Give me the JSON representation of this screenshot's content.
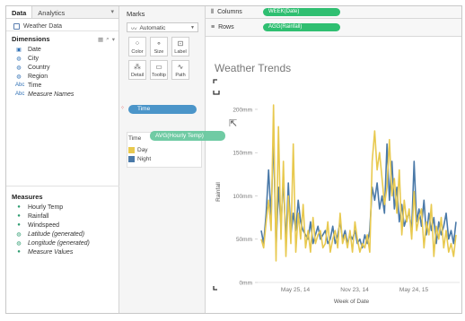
{
  "data_pane": {
    "tabs": [
      {
        "label": "Data",
        "active": true
      },
      {
        "label": "Analytics",
        "active": false
      }
    ],
    "datasource": "Weather Data",
    "dimensions_header": "Dimensions",
    "dimensions": [
      {
        "label": "Date",
        "icon": "calendar-icon"
      },
      {
        "label": "City",
        "icon": "globe-icon"
      },
      {
        "label": "Country",
        "icon": "globe-icon"
      },
      {
        "label": "Region",
        "icon": "globe-icon"
      },
      {
        "label": "Time",
        "icon": "abc-icon"
      },
      {
        "label": "Measure Names",
        "icon": "abc-icon",
        "italic": true
      }
    ],
    "measures_header": "Measures",
    "measures": [
      {
        "label": "Hourly Temp",
        "italic": false
      },
      {
        "label": "Rainfall",
        "italic": false
      },
      {
        "label": "Windspeed",
        "italic": false
      },
      {
        "label": "Latitude (generated)",
        "italic": true
      },
      {
        "label": "Longitude (generated)",
        "italic": true
      },
      {
        "label": "Measure Values",
        "italic": true
      }
    ]
  },
  "marks": {
    "title": "Marks",
    "mark_type": "Automatic",
    "buttons": [
      "Color",
      "Size",
      "Label",
      "Detail",
      "Tooltip",
      "Path"
    ],
    "color_pill": "Time",
    "legend_title": "Time",
    "legend_items": [
      {
        "label": "Day",
        "color": "#e8c94f"
      },
      {
        "label": "Night",
        "color": "#4a79a8"
      }
    ],
    "dragging_pill": "AVG(Hourly Temp)"
  },
  "shelves": {
    "columns_label": "Columns",
    "columns_pill": "WEEK(Date)",
    "rows_label": "Rows",
    "rows_pill": "AGG(Rainfall)"
  },
  "chart_data": {
    "type": "line",
    "title": "Weather Trends",
    "xlabel": "Week of Date",
    "ylabel": "Rainfall",
    "y_ticks": [
      "200mm",
      "150mm",
      "100mm",
      "50mm",
      "0mm"
    ],
    "x_ticks": [
      "May 25, 14",
      "Nov 23, 14",
      "May 24, 15"
    ],
    "ylim": [
      0,
      230
    ],
    "series": [
      {
        "name": "Day",
        "color": "#e8c94f",
        "values": [
          50,
          40,
          70,
          95,
          60,
          205,
          25,
          180,
          50,
          140,
          30,
          100,
          45,
          160,
          35,
          80,
          50,
          90,
          40,
          60,
          35,
          75,
          45,
          55,
          60,
          40,
          45,
          70,
          35,
          50,
          60,
          40,
          80,
          45,
          55,
          40,
          60,
          35,
          70,
          50,
          35,
          45,
          40,
          55,
          35,
          140,
          175,
          130,
          150,
          120,
          90,
          110,
          165,
          100,
          120,
          80,
          130,
          55,
          95,
          70,
          85,
          50,
          105,
          60,
          75,
          85,
          40,
          70,
          55,
          90,
          30,
          65,
          50,
          75,
          40,
          60,
          35,
          45,
          30,
          55
        ]
      },
      {
        "name": "Night",
        "color": "#4a79a8",
        "values": [
          60,
          45,
          80,
          130,
          75,
          170,
          40,
          110,
          65,
          120,
          45,
          115,
          55,
          80,
          60,
          95,
          70,
          60,
          55,
          50,
          70,
          45,
          55,
          65,
          50,
          55,
          60,
          45,
          50,
          65,
          45,
          55,
          70,
          50,
          60,
          45,
          55,
          50,
          60,
          45,
          50,
          40,
          55,
          45,
          60,
          110,
          95,
          115,
          85,
          100,
          80,
          160,
          95,
          140,
          85,
          110,
          70,
          90,
          65,
          75,
          80,
          60,
          140,
          70,
          85,
          65,
          95,
          55,
          80,
          60,
          75,
          45,
          70,
          55,
          65,
          80,
          50,
          60,
          45,
          70
        ]
      }
    ]
  }
}
